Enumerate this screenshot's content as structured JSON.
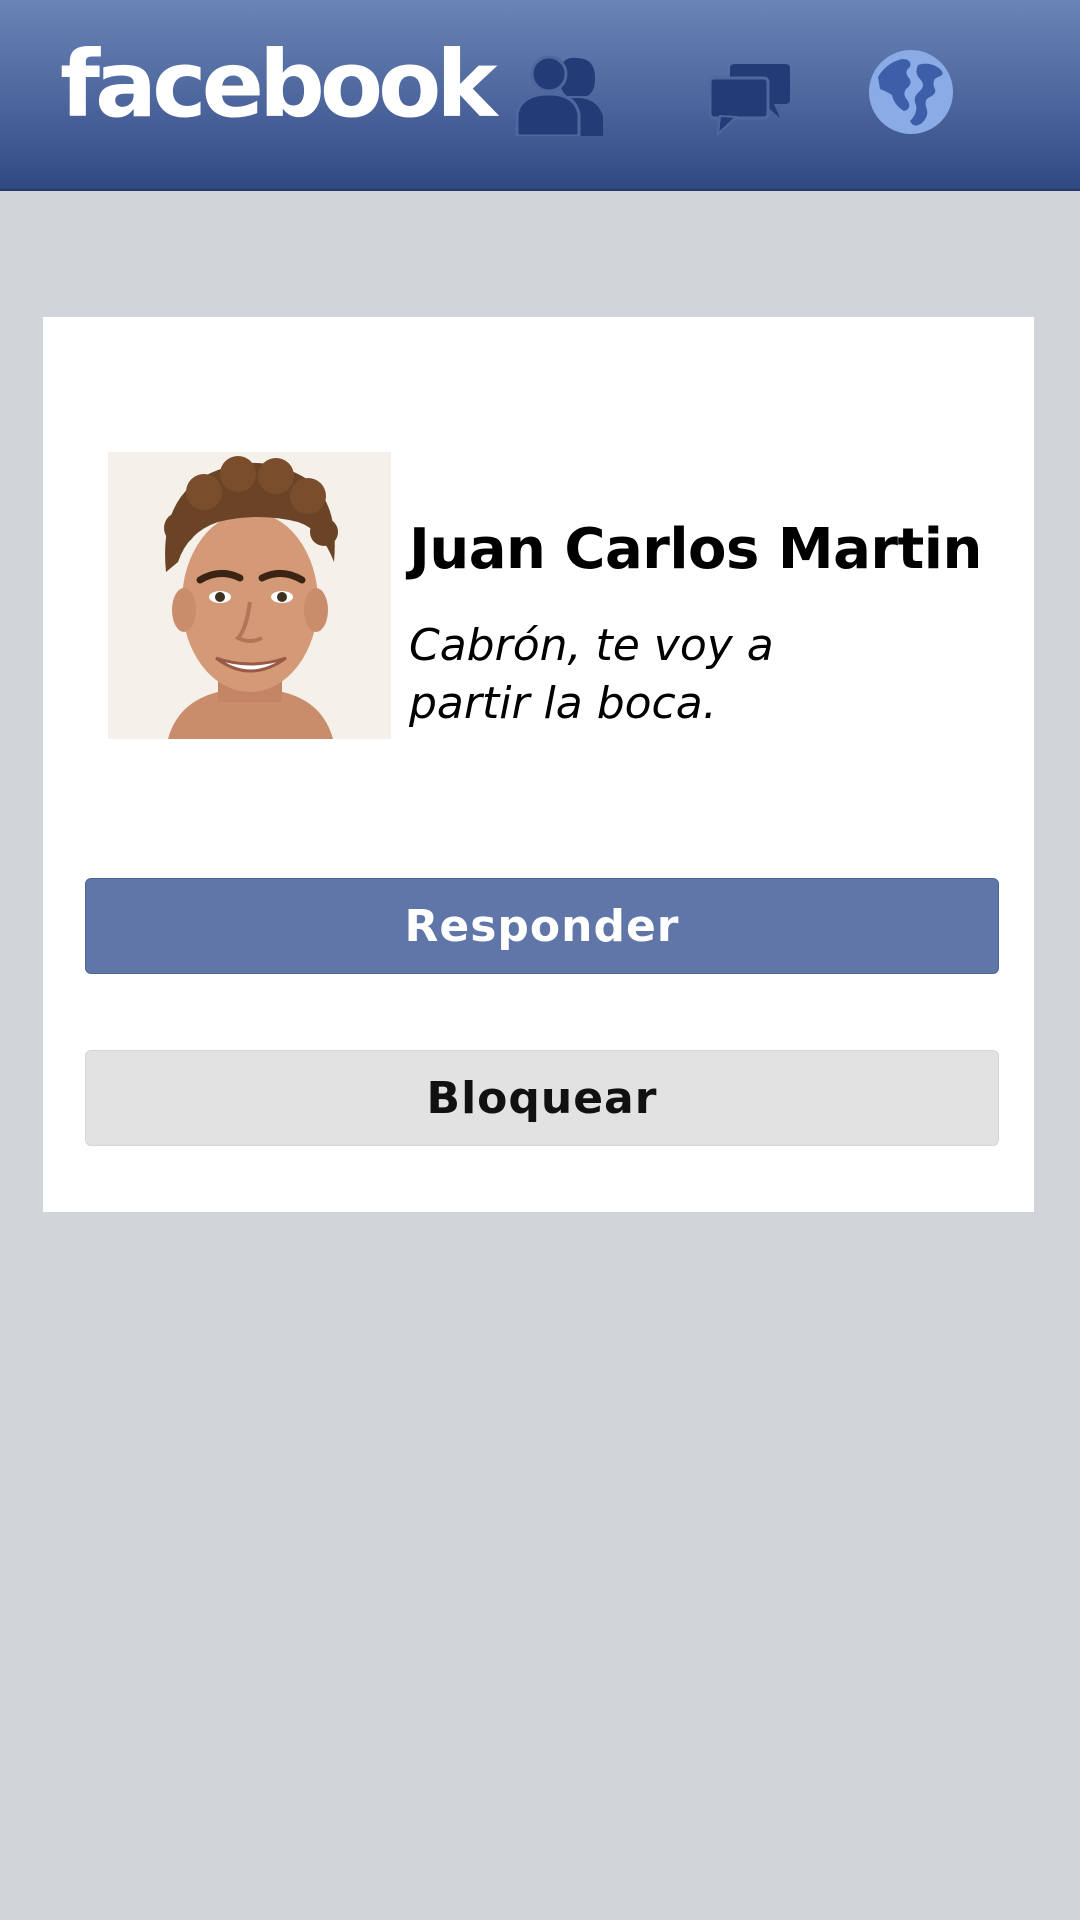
{
  "header": {
    "logo_text": "facebook",
    "icons": {
      "friends": "friends-icon",
      "messages": "messages-icon",
      "notifications": "globe-icon"
    },
    "colors": {
      "bar_top": "#6a84b7",
      "bar_bottom": "#2f4a83",
      "icon_dark": "#233c77",
      "globe_light": "#8aabe6"
    }
  },
  "message_card": {
    "sender_name": "Juan Carlos Martin",
    "message_text": "Cabrón, te voy a partir la boca.",
    "avatar": "avatar-photo",
    "reply_label": "Responder",
    "block_label": "Bloquear"
  },
  "colors": {
    "background": "#d1d4d9",
    "reply_button": "#6076a8",
    "block_button": "#e2e2e3"
  }
}
